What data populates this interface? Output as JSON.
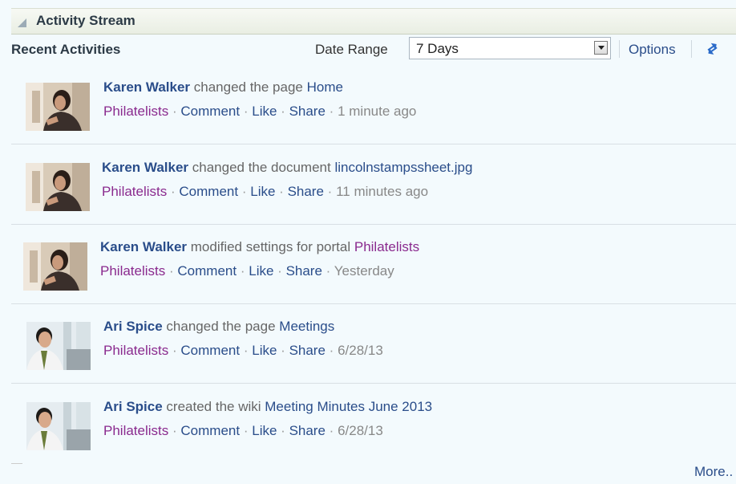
{
  "header": {
    "title": "Activity Stream"
  },
  "toolbar": {
    "recent_label": "Recent Activities",
    "date_range_label": "Date Range",
    "date_range_value": "7 Days",
    "options_label": "Options"
  },
  "activities": [
    {
      "author": "Karen Walker",
      "verb": " changed the page ",
      "target": "Home",
      "target_kind": "page",
      "portal": "Philatelists",
      "comment": "Comment",
      "like": "Like",
      "share": "Share",
      "time": "1 minute ago"
    },
    {
      "author": "Karen Walker",
      "verb": " changed the document ",
      "target": "lincolnstampssheet.jpg",
      "target_kind": "document",
      "portal": "Philatelists",
      "comment": "Comment",
      "like": "Like",
      "share": "Share",
      "time": "11 minutes ago"
    },
    {
      "author": "Karen Walker",
      "verb": " modified settings for portal ",
      "target": "Philatelists",
      "target_kind": "portal",
      "portal": "Philatelists",
      "comment": "Comment",
      "like": "Like",
      "share": "Share",
      "time": "Yesterday"
    },
    {
      "author": "Ari Spice",
      "verb": " changed the page ",
      "target": "Meetings",
      "target_kind": "page",
      "portal": "Philatelists",
      "comment": "Comment",
      "like": "Like",
      "share": "Share",
      "time": "6/28/13"
    },
    {
      "author": "Ari Spice",
      "verb": " created the wiki ",
      "target": "Meeting Minutes June 2013",
      "target_kind": "wiki",
      "portal": "Philatelists",
      "comment": "Comment",
      "like": "Like",
      "share": "Share",
      "time": "6/28/13"
    }
  ],
  "footer": {
    "more_label": "More.."
  },
  "colors": {
    "link": "#2a4d8a",
    "portal": "#8a2a8e",
    "muted": "#888888",
    "panel_bg": "#f3fafd"
  }
}
